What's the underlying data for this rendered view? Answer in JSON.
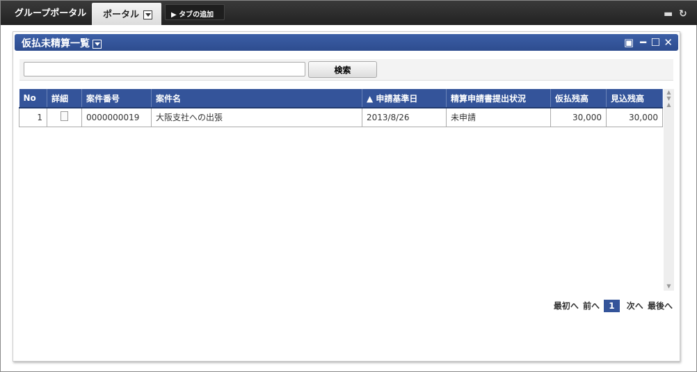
{
  "topbar": {
    "tabs": [
      "グループポータル",
      "ポータル"
    ],
    "add_tab": "タブの追加"
  },
  "portlet": {
    "title": "仮払未精算一覧",
    "search_value": "",
    "search_button": "検索"
  },
  "table": {
    "headers": [
      "No",
      "詳細",
      "案件番号",
      "案件名",
      "▲ 申請基準日",
      "精算申請書提出状況",
      "仮払残高",
      "見込残高"
    ],
    "rows": [
      {
        "no": "1",
        "number": "0000000019",
        "name": "大阪支社への出張",
        "date": "2013/8/26",
        "status": "未申請",
        "advance": "30,000",
        "expected": "30,000"
      }
    ]
  },
  "pager": {
    "first": "最初へ",
    "prev": "前へ",
    "current": "1",
    "next": "次へ",
    "last": "最後へ"
  }
}
